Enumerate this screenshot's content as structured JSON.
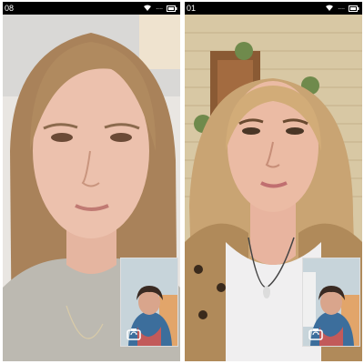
{
  "left_phone": {
    "status_bar": {
      "time": "08",
      "network": "....",
      "battery_label": "battery"
    },
    "main_video": {
      "icon": "video-feed"
    },
    "pip": {
      "icon": "self-view"
    },
    "switch_camera": {
      "icon": "camera-switch-icon"
    }
  },
  "right_phone": {
    "status_bar": {
      "time": "01",
      "network": "....",
      "battery_label": "battery"
    },
    "main_video": {
      "icon": "video-feed"
    },
    "pip": {
      "icon": "self-view"
    },
    "switch_camera": {
      "icon": "camera-switch-icon"
    }
  },
  "colors": {
    "statusbar": "#000000",
    "frame": "#ffffff",
    "accent": "#ffffff"
  }
}
